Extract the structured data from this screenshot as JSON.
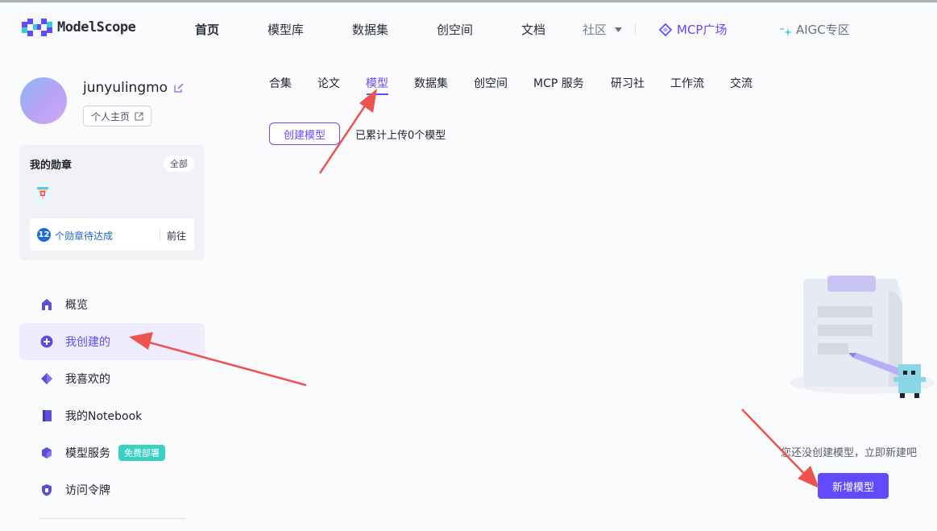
{
  "header": {
    "logo_text": "ModelScope",
    "nav": [
      {
        "label": "首页",
        "active": true
      },
      {
        "label": "模型库"
      },
      {
        "label": "数据集"
      },
      {
        "label": "创空间"
      },
      {
        "label": "文档"
      },
      {
        "label": "社区"
      }
    ],
    "community_dropdown_icon": "caret-down-icon",
    "mcp_label": "MCP广场",
    "aigc_label": "AIGC专区"
  },
  "profile": {
    "username": "junyulingmo",
    "home_button": "个人主页"
  },
  "badges": {
    "title": "我的勋章",
    "all_button": "全部",
    "pending_count": "12",
    "pending_label": "个勋章待达成",
    "go_label": "前往"
  },
  "sidebar": {
    "items": [
      {
        "label": "概览",
        "icon": "home-icon"
      },
      {
        "label": "我创建的",
        "icon": "create-icon",
        "active": true
      },
      {
        "label": "我喜欢的",
        "icon": "like-icon"
      },
      {
        "label": "我的Notebook",
        "icon": "notebook-icon"
      },
      {
        "label": "模型服务",
        "icon": "cube-icon",
        "tag": "免费部署"
      },
      {
        "label": "访问令牌",
        "icon": "token-icon"
      }
    ]
  },
  "tabs": [
    {
      "label": "合集"
    },
    {
      "label": "论文"
    },
    {
      "label": "模型",
      "active": true
    },
    {
      "label": "数据集"
    },
    {
      "label": "创空间"
    },
    {
      "label": "MCP 服务"
    },
    {
      "label": "研习社"
    },
    {
      "label": "工作流"
    },
    {
      "label": "交流"
    }
  ],
  "content": {
    "create_button": "创建模型",
    "upload_count": "已累计上传0个模型",
    "empty_text": "您还没创建模型，立即新建吧",
    "new_button": "新增模型"
  },
  "colors": {
    "accent": "#624aff",
    "annotation_arrow": "#ef5350",
    "tag": "#3ad1c2"
  }
}
